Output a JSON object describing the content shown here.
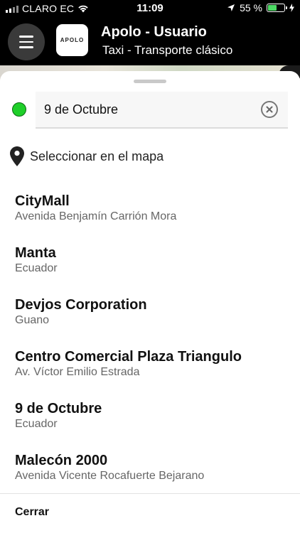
{
  "status_bar": {
    "carrier": "CLARO EC",
    "time": "11:09",
    "battery_percent": "55 %",
    "battery_level": 0.55,
    "battery_color": "#4cd964"
  },
  "header": {
    "menu_icon": "hamburger-menu-icon",
    "logo_text": "APOLO",
    "title": "Apolo - Usuario",
    "subtitle": "Taxi - Transporte clásico"
  },
  "search": {
    "value": "9 de Octubre",
    "origin_color": "#1fcf2a",
    "clear_icon": "clear-icon"
  },
  "select_on_map": {
    "icon": "map-pin-icon",
    "label": "Seleccionar en el mapa"
  },
  "results": [
    {
      "name": "CityMall",
      "address": "Avenida Benjamín Carrión Mora"
    },
    {
      "name": "Manta",
      "address": "Ecuador"
    },
    {
      "name": "Devjos Corporation",
      "address": "Guano"
    },
    {
      "name": "Centro Comercial Plaza Triangulo",
      "address": "Av. Víctor Emilio Estrada"
    },
    {
      "name": "9 de Octubre",
      "address": "Ecuador"
    },
    {
      "name": "Malecón 2000",
      "address": "Avenida Vicente Rocafuerte Bejarano"
    }
  ],
  "close_label": "Cerrar"
}
